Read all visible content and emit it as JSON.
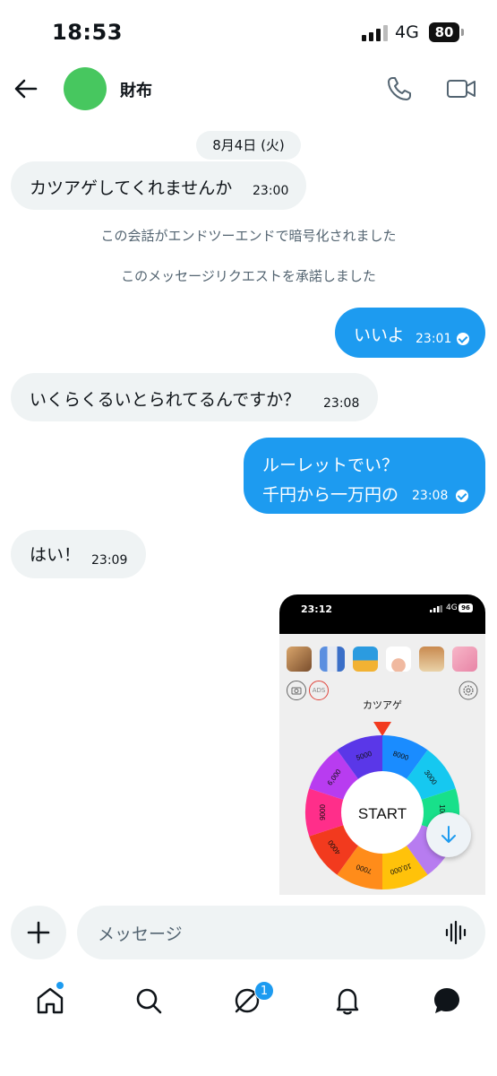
{
  "status_bar": {
    "time": "18:53",
    "network": "4G",
    "battery": "80"
  },
  "header": {
    "contact_name": "財布",
    "avatar_color": "#47c75f"
  },
  "chat": {
    "date_label": "8月4日 (火)",
    "messages": [
      {
        "direction": "incoming",
        "text": "カツアゲしてくれませんか",
        "time": "23:00"
      },
      {
        "direction": "system",
        "text": "この会話がエンドツーエンドで暗号化されました"
      },
      {
        "direction": "system",
        "text": "このメッセージリクエストを承諾しました"
      },
      {
        "direction": "outgoing",
        "text": "いいよ",
        "time": "23:01",
        "read": true
      },
      {
        "direction": "incoming",
        "text": "いくらくるいとられてるんですか？",
        "time": "23:08"
      },
      {
        "direction": "outgoing",
        "lines": [
          "ルーレットでい？",
          "千円から一万円の"
        ],
        "time": "23:08",
        "read": true
      },
      {
        "direction": "incoming",
        "text": "はい！",
        "time": "23:09"
      }
    ],
    "shared_image": {
      "status_time": "23:12",
      "status_network": "4G",
      "status_battery": "96",
      "ads_label": "ADS",
      "roulette_title": "カツアゲ",
      "start_label": "START",
      "wheel_segments": [
        {
          "label": "8000",
          "color": "#1a8cff"
        },
        {
          "label": "3000",
          "color": "#16c8f0"
        },
        {
          "label": "1000",
          "color": "#18e08a"
        },
        {
          "label": "",
          "color": "#b77cf0"
        },
        {
          "label": "10,000",
          "color": "#ffc20a"
        },
        {
          "label": "7000",
          "color": "#ff8c1a"
        },
        {
          "label": "4000",
          "color": "#f23a1e"
        },
        {
          "label": "9000",
          "color": "#ff2e8a"
        },
        {
          "label": "6,000",
          "color": "#b83cf0"
        },
        {
          "label": "5000",
          "color": "#5a37e8"
        }
      ]
    }
  },
  "composer": {
    "placeholder": "メッセージ"
  },
  "bottom_nav": {
    "messages_badge": "1"
  },
  "colors": {
    "accent": "#1d9bf0",
    "bubble_in": "#eff3f4",
    "muted_text": "#536471"
  }
}
